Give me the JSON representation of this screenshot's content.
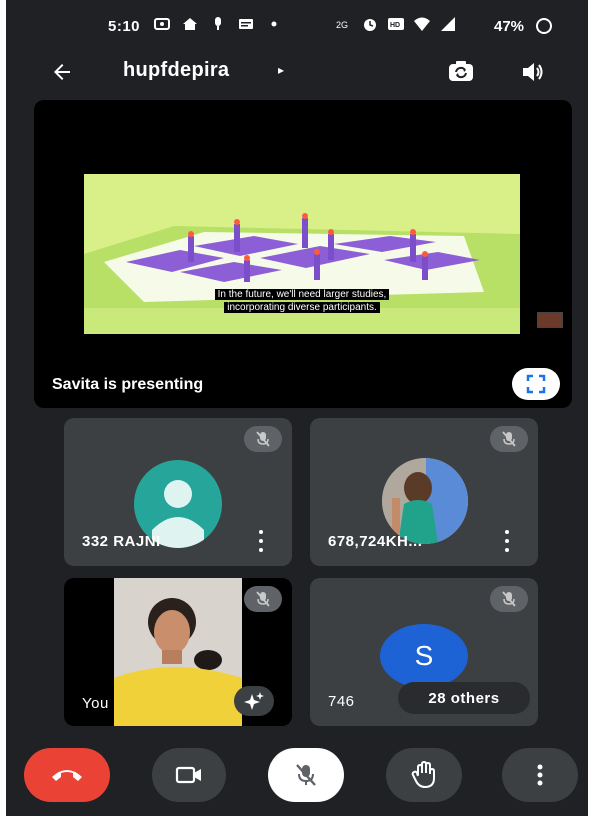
{
  "status_bar": {
    "time": "5:10",
    "battery_percent": "47%",
    "icons": [
      "cast-icon",
      "home-icon",
      "mic-icon",
      "message-icon",
      "dot-icon",
      "data-icon",
      "alarm-icon",
      "hd-icon",
      "wifi-icon",
      "signal-icon"
    ]
  },
  "header": {
    "meeting_code": "hupfdepira",
    "caret": "▸"
  },
  "presentation": {
    "caption_line1": "In the future, we'll need larger studies,",
    "caption_line2": "incorporating diverse participants.",
    "presenter_text": "Savita is presenting"
  },
  "tiles": [
    {
      "name": "332 RAJNI",
      "muted": true
    },
    {
      "name": "678,724KH...",
      "muted": true
    },
    {
      "name": "You",
      "muted": true
    },
    {
      "name": "746",
      "avatar_letter": "S",
      "others_label": "28 others",
      "muted": true
    }
  ],
  "colors": {
    "background": "#202124",
    "tile": "#3c4043",
    "end_call": "#ea4335",
    "avatar_teal": "#26a69a",
    "avatar_blue": "#1e63d6",
    "slide_bg": "#d9f089"
  }
}
